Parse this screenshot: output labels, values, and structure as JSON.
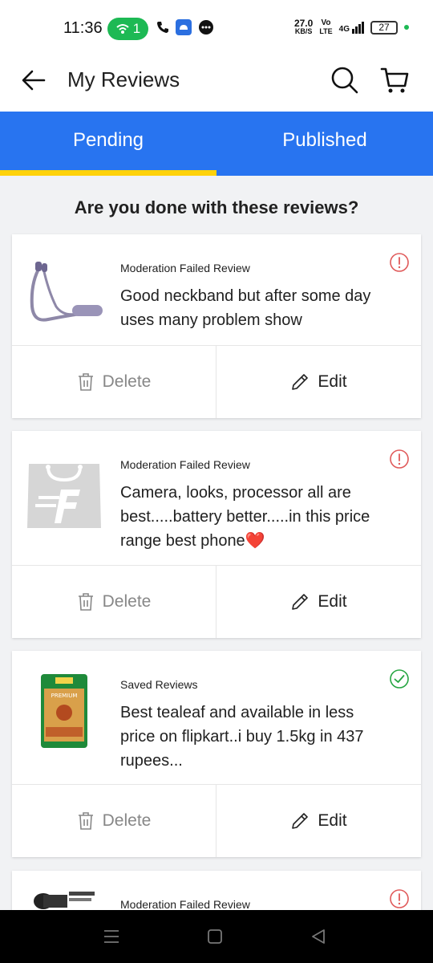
{
  "status_bar": {
    "time": "11:36",
    "hotspot_count": "1",
    "net_speed_value": "27.0",
    "net_speed_unit": "KB/S",
    "volte_top": "Vo",
    "volte_bottom": "LTE",
    "network": "4G",
    "battery": "27"
  },
  "header": {
    "title": "My Reviews"
  },
  "tabs": [
    {
      "label": "Pending",
      "active": true
    },
    {
      "label": "Published",
      "active": false
    }
  ],
  "section_heading": "Are you done with these reviews?",
  "reviews": [
    {
      "status": "Moderation Failed Review",
      "status_type": "error",
      "text": "Good neckband but after some day uses many problem show",
      "thumb": "neckband-image",
      "delete_label": "Delete",
      "edit_label": "Edit"
    },
    {
      "status": "Moderation Failed Review",
      "status_type": "error",
      "text": "Camera, looks, processor all are best.....battery better.....in this price range best phone❤️",
      "thumb": "placeholder-bag-image",
      "delete_label": "Delete",
      "edit_label": "Edit"
    },
    {
      "status": "Saved Reviews",
      "status_type": "success",
      "text": "Best tealeaf and available in less price on flipkart..i buy 1.5kg in 437 rupees...",
      "thumb": "tea-pack-image",
      "thumb_text": "PREMIUM",
      "delete_label": "Delete",
      "edit_label": "Edit"
    },
    {
      "status": "Moderation Failed Review",
      "status_type": "error",
      "thumb": "flashlight-image"
    }
  ],
  "colors": {
    "primary": "#2874f0",
    "tab_indicator": "#ffd20a",
    "error": "#e05a5a",
    "success": "#26a541"
  },
  "icons": {
    "back": "arrow-left-icon",
    "search": "search-icon",
    "cart": "cart-icon",
    "delete": "trash-icon",
    "edit": "pencil-icon"
  }
}
